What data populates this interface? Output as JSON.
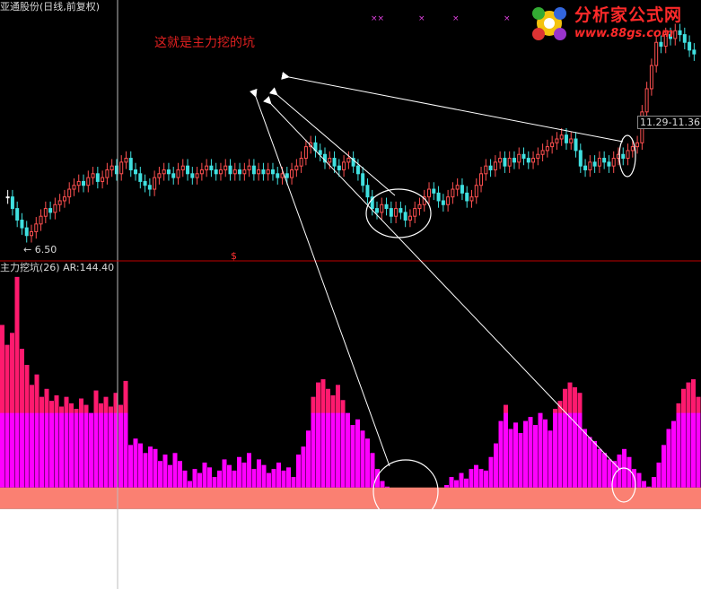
{
  "header": {
    "stock_title": "亚通股份(日线,前复权)",
    "low_label": "← 6.50",
    "range_label": "11.29-11.36",
    "dollar_marker": "$"
  },
  "annotation": {
    "text": "这就是主力挖的坑"
  },
  "indicator": {
    "title": "主力挖坑(26)  AR:144.40"
  },
  "logo": {
    "name": "分析家公式网",
    "url": "www.88gs.com"
  },
  "colors": {
    "background": "#000000",
    "up_candle": "#ff5050",
    "down_candle": "#40e0e0",
    "flat_candle": "#ffffff",
    "indicator_bar": "#ff00ff",
    "indicator_top": "#ff1a6e",
    "salmon_band": "#fa8072",
    "white_band": "#ffffff",
    "annotation": "#e02020",
    "separator": "#c00000"
  },
  "chart_data": [
    {
      "type": "candlestick",
      "title": "亚通股份(日线,前复权)",
      "price_min_label": 6.5,
      "price_range_label": "11.29-11.36",
      "ylim": [
        6.2,
        12.0
      ],
      "close": [
        7.6,
        7.3,
        7.0,
        6.8,
        6.6,
        6.7,
        6.9,
        7.1,
        7.3,
        7.2,
        7.4,
        7.5,
        7.6,
        7.8,
        7.9,
        8.0,
        7.9,
        8.1,
        8.2,
        8.0,
        8.1,
        8.3,
        8.4,
        8.2,
        8.5,
        8.6,
        8.3,
        8.2,
        8.0,
        7.9,
        7.8,
        8.1,
        8.2,
        8.3,
        8.2,
        8.1,
        8.3,
        8.4,
        8.2,
        8.1,
        8.2,
        8.3,
        8.4,
        8.3,
        8.2,
        8.3,
        8.4,
        8.2,
        8.3,
        8.2,
        8.3,
        8.4,
        8.2,
        8.3,
        8.2,
        8.3,
        8.2,
        8.1,
        8.2,
        8.1,
        8.3,
        8.4,
        8.6,
        8.9,
        9.0,
        8.8,
        8.7,
        8.5,
        8.6,
        8.4,
        8.3,
        8.5,
        8.6,
        8.4,
        8.2,
        7.9,
        7.6,
        7.3,
        7.2,
        7.4,
        7.3,
        7.1,
        7.3,
        7.2,
        7.0,
        7.1,
        7.3,
        7.4,
        7.6,
        7.8,
        7.7,
        7.5,
        7.4,
        7.6,
        7.8,
        7.9,
        7.7,
        7.5,
        7.6,
        7.9,
        8.2,
        8.4,
        8.3,
        8.5,
        8.6,
        8.4,
        8.6,
        8.5,
        8.7,
        8.6,
        8.5,
        8.6,
        8.7,
        8.8,
        8.9,
        9.0,
        9.1,
        9.2,
        9.0,
        9.1,
        8.8,
        8.4,
        8.3,
        8.5,
        8.4,
        8.6,
        8.5,
        8.4,
        8.6,
        8.7,
        8.6,
        8.8,
        8.9,
        9.0,
        9.8,
        10.4,
        11.0,
        11.6,
        11.5,
        11.8,
        11.7,
        11.9,
        11.8,
        11.6,
        11.4,
        11.3
      ]
    },
    {
      "type": "bar",
      "title": "主力挖坑(26)",
      "series_name": "AR",
      "last_value": 144.4,
      "ylim": [
        0,
        400
      ],
      "salmon_level": 100,
      "pink_level": 220,
      "values": [
        330,
        305,
        320,
        390,
        300,
        280,
        255,
        268,
        240,
        250,
        235,
        242,
        228,
        240,
        232,
        225,
        238,
        230,
        220,
        248,
        232,
        240,
        228,
        245,
        230,
        260,
        180,
        188,
        182,
        170,
        178,
        175,
        160,
        168,
        155,
        170,
        160,
        148,
        135,
        150,
        145,
        158,
        152,
        140,
        148,
        162,
        155,
        148,
        165,
        158,
        170,
        150,
        162,
        155,
        145,
        150,
        158,
        148,
        152,
        140,
        168,
        178,
        198,
        240,
        258,
        262,
        250,
        242,
        255,
        236,
        220,
        205,
        212,
        198,
        188,
        170,
        150,
        135,
        128,
        118,
        115,
        104,
        98,
        95,
        94,
        98,
        105,
        112,
        118,
        125,
        130,
        140,
        136,
        145,
        138,
        150,
        155,
        150,
        148,
        165,
        182,
        210,
        230,
        200,
        208,
        195,
        210,
        215,
        205,
        220,
        212,
        198,
        225,
        235,
        250,
        258,
        252,
        245,
        200,
        190,
        185,
        175,
        170,
        162,
        160,
        168,
        175,
        165,
        150,
        145,
        135,
        128,
        140,
        158,
        180,
        200,
        210,
        232,
        250,
        258,
        262,
        240
      ]
    }
  ]
}
